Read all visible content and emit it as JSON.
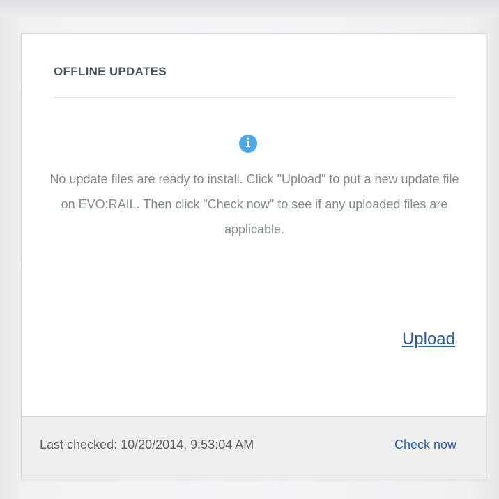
{
  "panel": {
    "title": "OFFLINE UPDATES",
    "info_icon": "info-icon",
    "message": "No update files are ready to install. Click \"Upload\" to put a new update file on EVO:RAIL. Then click \"Check now\" to see if any uploaded files are applicable.",
    "upload_label": "Upload"
  },
  "footer": {
    "last_checked": "Last checked: 10/20/2014, 9:53:04 AM",
    "check_now_label": "Check now"
  },
  "colors": {
    "accent_link": "#2a5ea8",
    "info_icon": "#4ea7e6",
    "title_text": "#4a5560",
    "body_text": "#858a8f"
  }
}
